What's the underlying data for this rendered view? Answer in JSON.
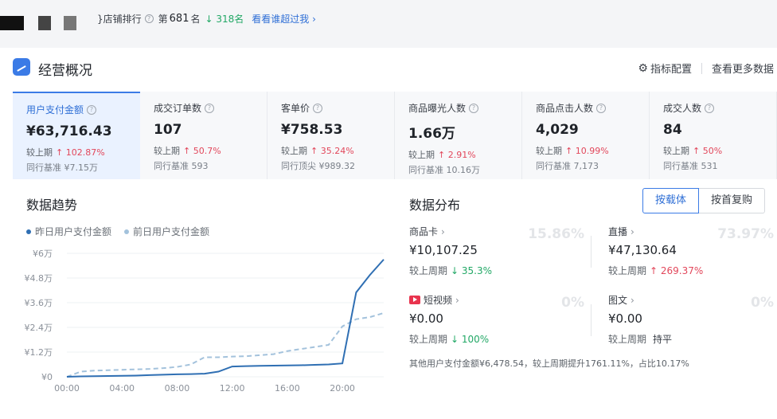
{
  "top": {
    "rank_label": "}店铺排行",
    "rank_prefix": "第",
    "rank_number": "681",
    "rank_suffix": "名",
    "rank_change": "↓ 318名",
    "see_who_link": "看看谁超过我 ›"
  },
  "header": {
    "title": "经营概况",
    "metric_config": "指标配置",
    "more_data": "查看更多数据"
  },
  "metrics": [
    {
      "label": "用户支付金额",
      "value": "¥63,716.43",
      "cmp_label": "较上期",
      "cmp_value": "↑ 102.87%",
      "peer": "同行基准 ¥7.15万"
    },
    {
      "label": "成交订单数",
      "value": "107",
      "cmp_label": "较上期",
      "cmp_value": "↑ 50.7%",
      "peer": "同行基准 593"
    },
    {
      "label": "客单价",
      "value": "¥758.53",
      "cmp_label": "较上期",
      "cmp_value": "↑ 35.24%",
      "peer": "同行顶尖 ¥989.32"
    },
    {
      "label": "商品曝光人数",
      "value": "1.66万",
      "cmp_label": "较上期",
      "cmp_value": "↑ 2.91%",
      "peer": "同行基准 10.16万"
    },
    {
      "label": "商品点击人数",
      "value": "4,029",
      "cmp_label": "较上期",
      "cmp_value": "↑ 10.99%",
      "peer": "同行基准 7,173"
    },
    {
      "label": "成交人数",
      "value": "84",
      "cmp_label": "较上期",
      "cmp_value": "↑ 50%",
      "peer": "同行基准 531"
    }
  ],
  "trend": {
    "title": "数据趋势",
    "legend_yesterday": "昨日用户支付金额",
    "legend_daybefore": "前日用户支付金额"
  },
  "chart_data": {
    "type": "line",
    "x": [
      "00:00",
      "01:00",
      "02:00",
      "03:00",
      "04:00",
      "05:00",
      "06:00",
      "07:00",
      "08:00",
      "09:00",
      "10:00",
      "11:00",
      "12:00",
      "13:00",
      "14:00",
      "15:00",
      "16:00",
      "17:00",
      "18:00",
      "19:00",
      "20:00",
      "21:00",
      "22:00",
      "23:00"
    ],
    "xticks": [
      "00:00",
      "04:00",
      "08:00",
      "12:00",
      "16:00",
      "20:00"
    ],
    "yticks": [
      "¥0",
      "¥1.2万",
      "¥2.4万",
      "¥3.6万",
      "¥4.8万",
      "¥6万"
    ],
    "ylim": [
      0,
      60000
    ],
    "series": [
      {
        "name": "昨日用户支付金额",
        "color": "#2f6fb3",
        "values": [
          0,
          200,
          300,
          400,
          500,
          600,
          800,
          1000,
          1200,
          1300,
          1500,
          2500,
          5000,
          5200,
          5300,
          5400,
          5500,
          5600,
          5800,
          6000,
          6500,
          41000,
          49500,
          57000
        ]
      },
      {
        "name": "前日用户支付金额",
        "color": "#a3c2dc",
        "values": [
          0,
          2500,
          3000,
          3200,
          3400,
          3600,
          3800,
          4200,
          4800,
          6000,
          9500,
          9500,
          9800,
          10000,
          10500,
          11000,
          12500,
          13500,
          14500,
          15500,
          24500,
          28000,
          29000,
          31000
        ]
      }
    ]
  },
  "distribution": {
    "title": "数据分布",
    "btn_carrier": "按载体",
    "btn_first": "按首复购",
    "cards": [
      {
        "title": "商品卡",
        "value": "¥10,107.25",
        "cmp_label": "较上周期",
        "cmp_value": "↓ 35.3%",
        "pct": "15.86%"
      },
      {
        "title": "直播",
        "value": "¥47,130.64",
        "cmp_label": "较上周期",
        "cmp_value": "↑ 269.37%",
        "pct": "73.97%"
      },
      {
        "title": "短视频",
        "value": "¥0.00",
        "cmp_label": "较上周期",
        "cmp_value": "↓ 100%",
        "pct": "0%"
      },
      {
        "title": "图文",
        "value": "¥0.00",
        "cmp_label": "较上周期",
        "cmp_value": "持平",
        "pct": "0%"
      }
    ],
    "other_text": "其他用户支付金额¥6,478.54，较上周期提升1761.11%，占比10.17%"
  }
}
